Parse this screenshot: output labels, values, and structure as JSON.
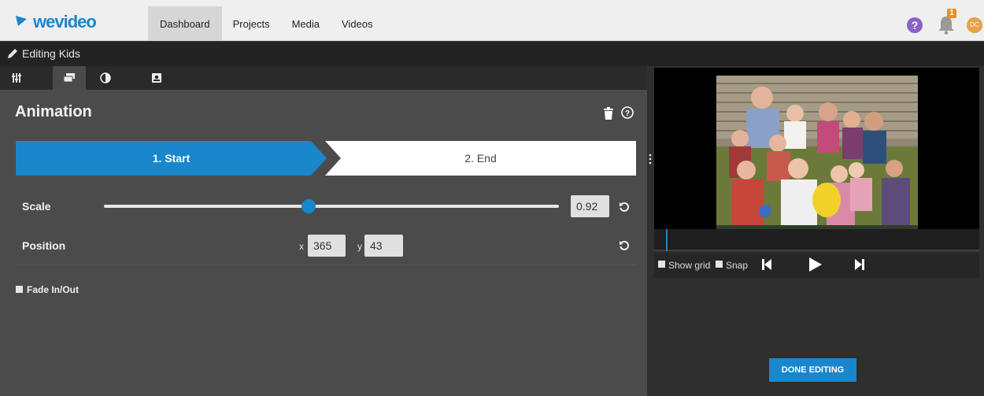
{
  "app": {
    "brand": "wevideo",
    "notifications_count": "1",
    "avatar_initials": "DC",
    "help_label": "?"
  },
  "nav": {
    "tabs": [
      {
        "label": "Dashboard",
        "active": true
      },
      {
        "label": "Projects"
      },
      {
        "label": "Media"
      },
      {
        "label": "Videos"
      }
    ]
  },
  "editor": {
    "title": "Editing Kids"
  },
  "tools": [
    "sliders-icon",
    "layers-icon",
    "contrast-icon",
    "portrait-icon"
  ],
  "panel": {
    "section_title": "Animation",
    "steps": [
      {
        "label": "1. Start",
        "active": true
      },
      {
        "label": "2. End"
      }
    ],
    "scale": {
      "label": "Scale",
      "value": "0.92",
      "fraction": 0.45
    },
    "position": {
      "label": "Position",
      "x_label": "x",
      "x": "365",
      "y_label": "y",
      "y": "43"
    },
    "fade": {
      "label": "Fade In/Out",
      "checked": false
    }
  },
  "preview": {
    "show_grid_label": "Show grid",
    "snap_label": "Snap",
    "done_label": "DONE EDITING"
  },
  "colors": {
    "accent": "#1a86cc",
    "notification": "#f08c1c",
    "help": "#8a62c7"
  }
}
